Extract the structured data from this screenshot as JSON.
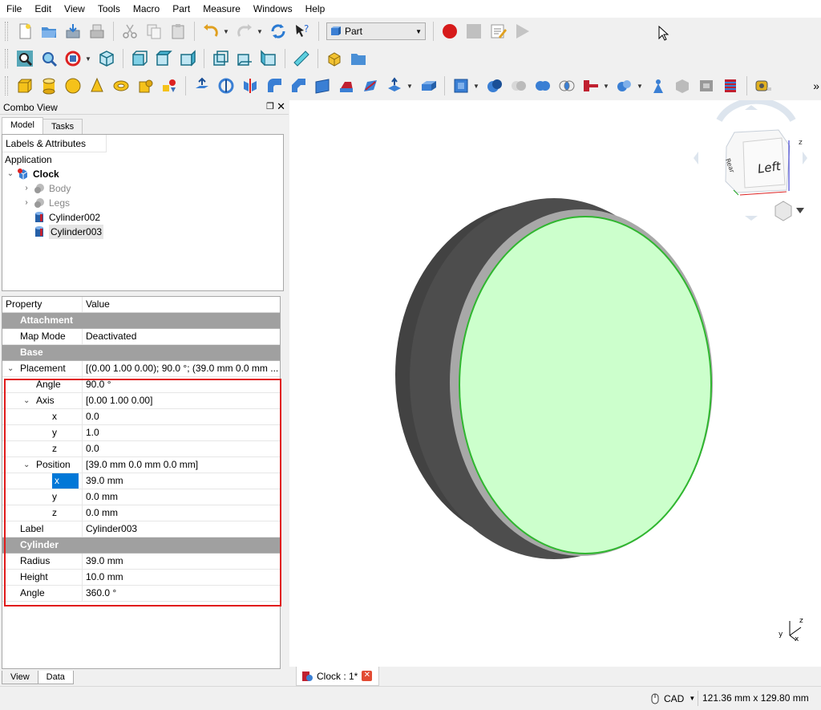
{
  "menu": [
    "File",
    "Edit",
    "View",
    "Tools",
    "Macro",
    "Part",
    "Measure",
    "Windows",
    "Help"
  ],
  "workbench": {
    "label": "Part"
  },
  "combo": {
    "title": "Combo View",
    "tabs": [
      "Model",
      "Tasks"
    ],
    "bottom_tabs": [
      "View",
      "Data"
    ]
  },
  "tree": {
    "header": "Labels & Attributes",
    "root": "Application",
    "document": "Clock",
    "items": [
      {
        "label": "Body",
        "dim": true,
        "expandable": true
      },
      {
        "label": "Legs",
        "dim": true,
        "expandable": true
      },
      {
        "label": "Cylinder002",
        "dim": false,
        "expandable": false
      },
      {
        "label": "Cylinder003",
        "dim": false,
        "expandable": false,
        "selected": true
      }
    ]
  },
  "properties": {
    "col_property": "Property",
    "col_value": "Value",
    "rows": [
      {
        "type": "group",
        "name": "Attachment"
      },
      {
        "type": "prop",
        "name": "Map Mode",
        "value": "Deactivated",
        "level": 1
      },
      {
        "type": "group",
        "name": "Base"
      },
      {
        "type": "prop",
        "name": "Placement",
        "value": "[(0.00 1.00 0.00); 90.0 °; (39.0 mm  0.0 mm  ...",
        "level": 1,
        "expanded": true
      },
      {
        "type": "prop",
        "name": "Angle",
        "value": "90.0 °",
        "level": 2
      },
      {
        "type": "prop",
        "name": "Axis",
        "value": "[0.00 1.00 0.00]",
        "level": 2,
        "expanded": true
      },
      {
        "type": "prop",
        "name": "x",
        "value": "0.0",
        "level": 3
      },
      {
        "type": "prop",
        "name": "y",
        "value": "1.0",
        "level": 3
      },
      {
        "type": "prop",
        "name": "z",
        "value": "0.0",
        "level": 3
      },
      {
        "type": "prop",
        "name": "Position",
        "value": "[39.0 mm  0.0 mm  0.0 mm]",
        "level": 2,
        "expanded": true
      },
      {
        "type": "prop",
        "name": "x",
        "value": "39.0 mm",
        "level": 3,
        "highlight": true
      },
      {
        "type": "prop",
        "name": "y",
        "value": "0.0 mm",
        "level": 3
      },
      {
        "type": "prop",
        "name": "z",
        "value": "0.0 mm",
        "level": 3
      },
      {
        "type": "prop",
        "name": "Label",
        "value": "Cylinder003",
        "level": 1
      },
      {
        "type": "group",
        "name": "Cylinder"
      },
      {
        "type": "prop",
        "name": "Radius",
        "value": "39.0 mm",
        "level": 1
      },
      {
        "type": "prop",
        "name": "Height",
        "value": "10.0 mm",
        "level": 1
      },
      {
        "type": "prop",
        "name": "Angle",
        "value": "360.0 °",
        "level": 1
      }
    ]
  },
  "navcube": {
    "face_label": "Left",
    "axis_z": "z",
    "axis_y": "y",
    "axis_x": "x"
  },
  "doc_tab": {
    "label": "Clock : 1*"
  },
  "status": {
    "nav_style": "CAD",
    "dimensions": "121.36 mm x 129.80 mm"
  },
  "colors": {
    "face": "#ccffcc",
    "face_edge": "#2fb62f",
    "rim": "#444444",
    "selection_box": "#e11b1b",
    "highlight": "#0078d7"
  }
}
